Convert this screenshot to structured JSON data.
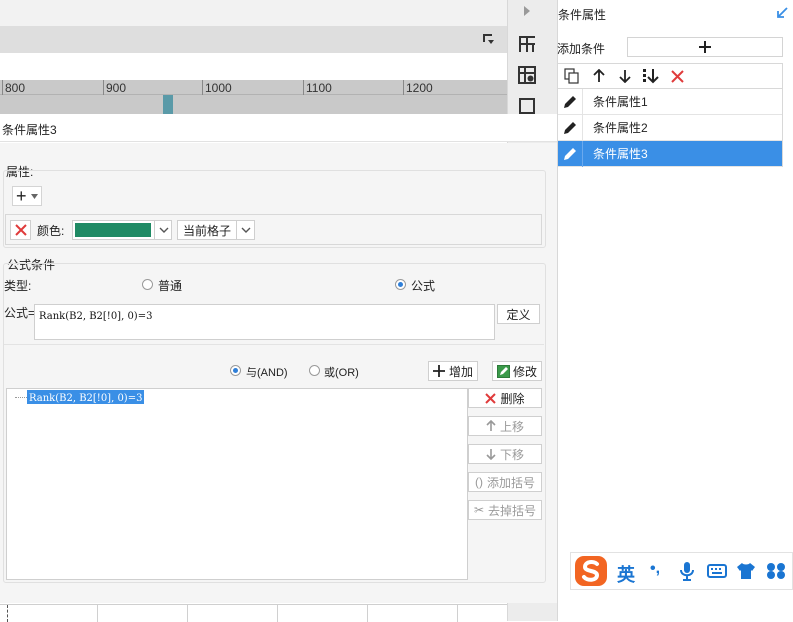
{
  "ruler": {
    "ticks": [
      "800",
      "900",
      "1000",
      "1100",
      "1200"
    ]
  },
  "dialog": {
    "title": "条件属性3"
  },
  "properties": {
    "section_label": "属性:",
    "add_button": "+",
    "color_label": "颜色:",
    "color_value": "#1f8a64",
    "scope_value": "当前格子"
  },
  "formula_condition": {
    "section_label": "公式条件",
    "type_label": "类型:",
    "type_normal": "普通",
    "type_formula": "公式",
    "selected_type": "公式",
    "formula_label": "公式=",
    "formula_value": "Rank(B2, B2[!0], 0)=3",
    "define_button": "定义",
    "and_label": "与(AND)",
    "or_label": "或(OR)",
    "selected_logic": "与(AND)",
    "add_button": "增加",
    "modify_button": "修改",
    "delete_button": "删除",
    "move_up_button": "上移",
    "move_down_button": "下移",
    "add_bracket_button": "添加括号",
    "remove_bracket_button": "去掉括号",
    "conditions": [
      "Rank(B2, B2[!0], 0)=3"
    ]
  },
  "right_panel": {
    "title": "条件属性",
    "add_condition_label": "添加条件",
    "add_condition_button": "+",
    "items": [
      "条件属性1",
      "条件属性2",
      "条件属性3"
    ],
    "selected_item": "条件属性3"
  },
  "ime": {
    "lang_label": "英",
    "punct_label": "•,"
  },
  "colors": {
    "accent": "#3a8fe6",
    "selected_row": "#3a8fe6",
    "delete_red": "#e03b3b",
    "ime_orange": "#f26522"
  }
}
